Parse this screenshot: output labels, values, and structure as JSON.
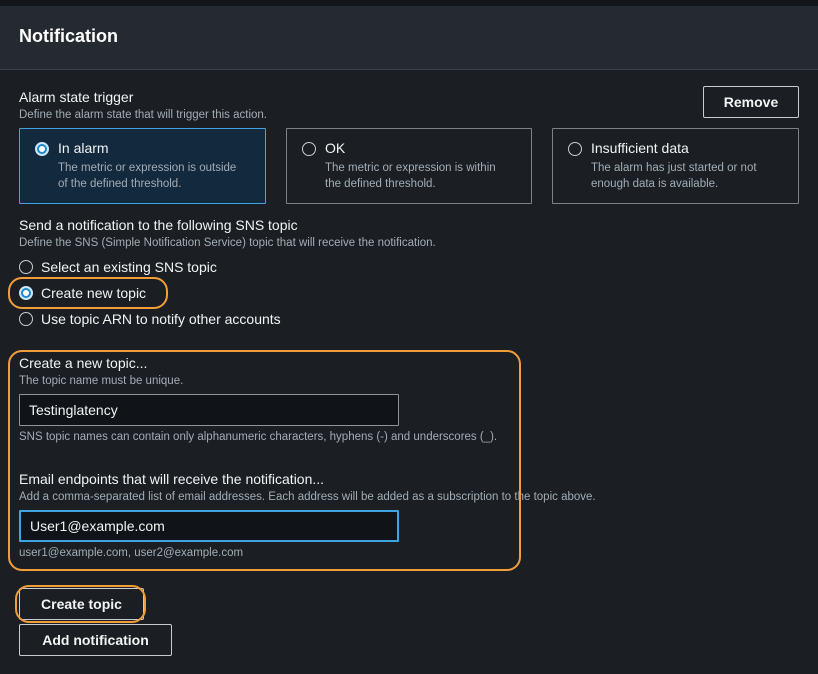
{
  "header": {
    "title": "Notification"
  },
  "alarm_trigger": {
    "label": "Alarm state trigger",
    "description": "Define the alarm state that will trigger this action.",
    "remove_label": "Remove",
    "options": [
      {
        "title": "In alarm",
        "line1": "The metric or expression is outside",
        "line2": "of the defined threshold.",
        "selected": true
      },
      {
        "title": "OK",
        "line1": "The metric or expression is within",
        "line2": "the defined threshold.",
        "selected": false
      },
      {
        "title": "Insufficient data",
        "line1": "The alarm has just started or not",
        "line2": "enough data is available.",
        "selected": false
      }
    ]
  },
  "sns": {
    "label": "Send a notification to the following SNS topic",
    "description": "Define the SNS (Simple Notification Service) topic that will receive the notification.",
    "options": [
      {
        "label": "Select an existing SNS topic",
        "selected": false
      },
      {
        "label": "Create new topic",
        "selected": true
      },
      {
        "label": "Use topic ARN to notify other accounts",
        "selected": false
      }
    ]
  },
  "new_topic": {
    "label": "Create a new topic...",
    "description": "The topic name must be unique.",
    "value": "Testinglatency",
    "hint": "SNS topic names can contain only alphanumeric characters, hyphens (-) and underscores (_)."
  },
  "email": {
    "label": "Email endpoints that will receive the notification...",
    "description": "Add a comma-separated list of email addresses. Each address will be added as a subscription to the topic above.",
    "value": "User1@example.com",
    "hint": "user1@example.com, user2@example.com"
  },
  "actions": {
    "create_topic": "Create topic",
    "add_notification": "Add notification"
  },
  "colors": {
    "accent": "#3fa4e0",
    "highlight": "#f19d38",
    "background": "#1b1f24"
  }
}
